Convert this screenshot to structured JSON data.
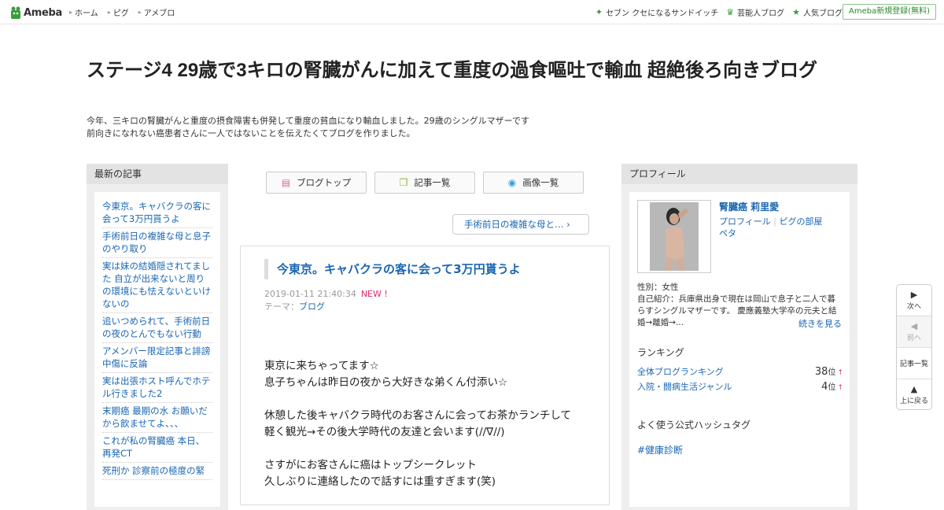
{
  "header": {
    "logo": "Ameba",
    "nav": [
      "ホーム",
      "ピグ",
      "アメブロ"
    ],
    "links": [
      {
        "icon": "sparkle-icon",
        "label": "セブン クセになるサンドイッチ"
      },
      {
        "icon": "crown-icon",
        "label": "芸能人ブログ"
      },
      {
        "icon": "star-icon",
        "label": "人気ブログ"
      }
    ],
    "register": "Ameba新規登録(無料)"
  },
  "blog": {
    "title": "ステージ4 29歳で3キロの腎臓がんに加えて重度の過食嘔吐で輸血 超絶後ろ向きブログ",
    "description_line1": "今年、三キロの腎臓がんと重度の摂食障害も併発して重度の貧血になり輸血しました。29歳のシングルマザーです",
    "description_line2": "前向きになれない癌患者さんに一人ではないことを伝えたくてブログを作りました。"
  },
  "recent": {
    "heading": "最新の記事",
    "items": [
      "今東京。キャバクラの客に会って3万円貰うよ",
      "手術前日の複雑な母と息子のやり取り",
      "実は妹の結婚隠されてました 自立が出来ないと周りの環境にも怯えないといけないの",
      "追いつめられて、手術前日の夜のとんでもない行動",
      "アメンバー限定記事と誹謗中傷に反論",
      "実は出張ホスト呼んでホテル行きました2",
      "末期癌 最期の水 お願いだから飲ませてよ、、、",
      "これが私の腎臓癌 本日、再発CT",
      "死刑か 診察前の極度の緊"
    ]
  },
  "middle": {
    "buttons": [
      "ブログトップ",
      "記事一覧",
      "画像一覧"
    ],
    "prev_link": "手術前日の複雑な母と…",
    "article": {
      "title": "今東京。キャバクラの客に会って3万円貰うよ",
      "date": "2019-01-11 21:40:34",
      "new_badge": "NEW !",
      "theme_label": "テーマ：",
      "theme": "ブログ",
      "para1_line1": "東京に来ちゃってます☆",
      "para1_line2": "息子ちゃんは昨日の夜から大好きな弟くん付添い☆",
      "para2_line1": "休憩した後キャバクラ時代のお客さんに会ってお茶かランチして",
      "para2_line2": "軽く観光→その後大学時代の友達と会います(//∇//)",
      "para3_line1": "さすがにお客さんに癌はトップシークレット",
      "para3_line2": "久しぶりに連絡したので話すには重すぎます(笑)"
    }
  },
  "profile": {
    "heading": "プロフィール",
    "name": "腎臓癌 莉里愛",
    "links": [
      "プロフィール",
      "ピグの部屋",
      "ペタ"
    ],
    "gender": "性別：女性",
    "intro": "自己紹介：兵庫県出身で現在は岡山で息子と二人で暮らすシングルマザーです。 慶應義塾大学卒の元夫と結婚→離婚→...",
    "more": "続きを見る",
    "ranking_heading": "ランキング",
    "rankings": [
      {
        "label": "全体ブログランキング",
        "value": "38",
        "unit": "位",
        "arrow": "↑"
      },
      {
        "label": "入院・闘病生活ジャンル",
        "value": "4",
        "unit": "位",
        "arrow": "↑"
      }
    ],
    "hashtag_heading": "よく使う公式ハッシュタグ",
    "hashtag": "#健康診断"
  },
  "sidenav": {
    "next": "次へ",
    "prev": "前へ",
    "list": "記事一覧",
    "top": "上に戻る"
  },
  "colors": {
    "link": "#1a66b4",
    "new_badge": "#e0286e",
    "ameba_green": "#3a9c3a"
  }
}
